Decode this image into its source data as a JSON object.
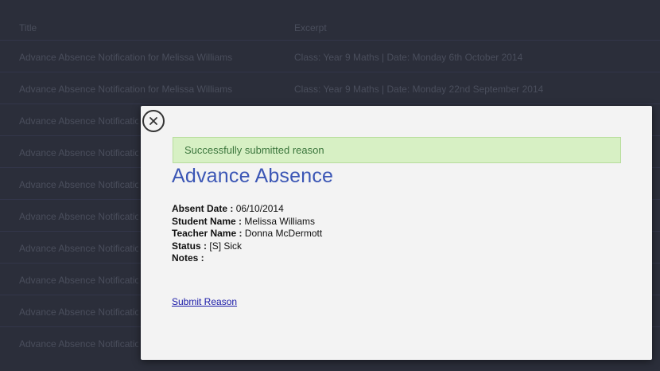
{
  "background_table": {
    "headers": [
      "Title",
      "Excerpt"
    ],
    "rows": [
      [
        "Advance Absence Notification for Melissa Williams",
        "Class: Year 9 Maths | Date: Monday 6th October 2014"
      ],
      [
        "Advance Absence Notification for Melissa Williams",
        "Class: Year 9 Maths | Date: Monday 22nd September 2014"
      ],
      [
        "Advance Absence Notification",
        ""
      ],
      [
        "Advance Absence Notification",
        ""
      ],
      [
        "Advance Absence Notification",
        ""
      ],
      [
        "Advance Absence Notification",
        ""
      ],
      [
        "Advance Absence Notification",
        ""
      ],
      [
        "Advance Absence Notification",
        ""
      ],
      [
        "Advance Absence Notification",
        ""
      ],
      [
        "Advance Absence Notification",
        ""
      ]
    ]
  },
  "modal": {
    "alert": "Successfully submitted reason",
    "title": "Advance Absence",
    "fields": [
      {
        "label": "Absent Date",
        "value": "06/10/2014"
      },
      {
        "label": "Student Name",
        "value": "Melissa Williams"
      },
      {
        "label": "Teacher Name",
        "value": "Donna McDermott"
      },
      {
        "label": "Status",
        "value": "[S] Sick"
      },
      {
        "label": "Notes",
        "value": ""
      }
    ],
    "submit_link": "Submit Reason"
  },
  "icons": {
    "close": "close-icon"
  }
}
